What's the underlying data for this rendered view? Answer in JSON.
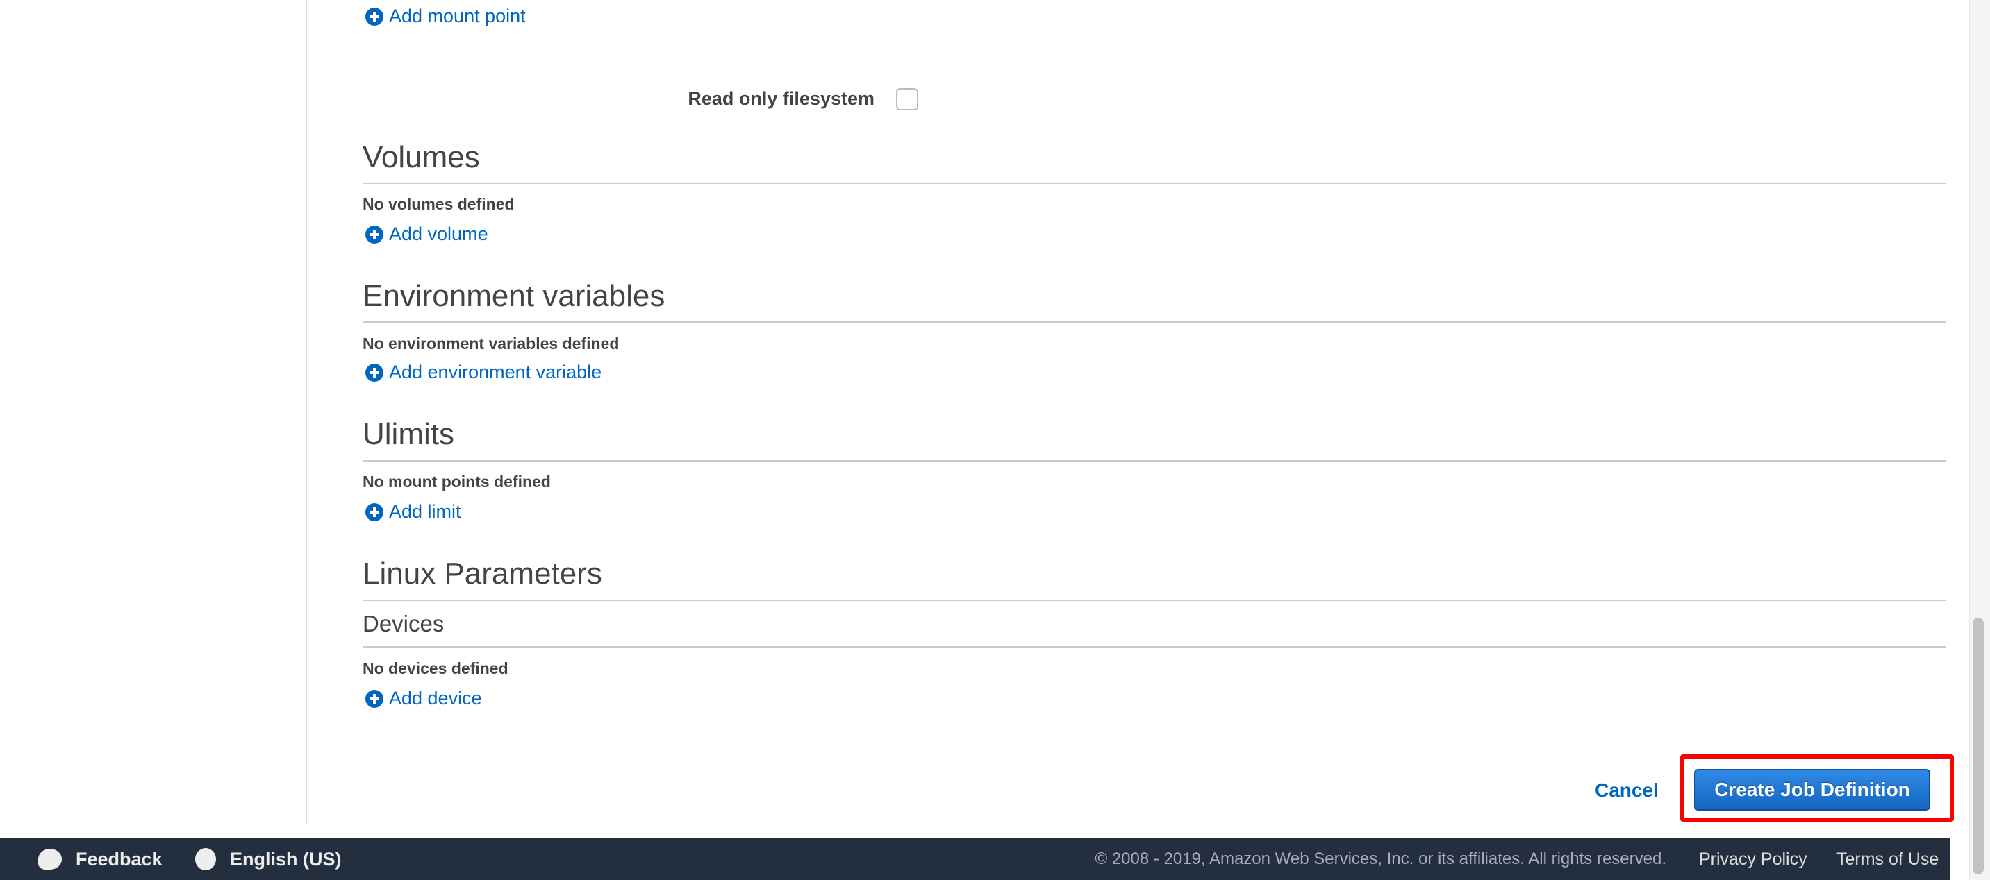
{
  "form": {
    "add_mount_point": "Add mount point",
    "read_only_label": "Read only filesystem",
    "read_only_checked": false,
    "sections": {
      "volumes": {
        "title": "Volumes",
        "empty": "No volumes defined",
        "add": "Add volume"
      },
      "env": {
        "title": "Environment variables",
        "empty": "No environment variables defined",
        "add": "Add environment variable"
      },
      "ulimits": {
        "title": "Ulimits",
        "empty": "No mount points defined",
        "add": "Add limit"
      },
      "linux": {
        "title": "Linux Parameters",
        "devices_title": "Devices",
        "empty": "No devices defined",
        "add": "Add device"
      }
    },
    "cancel": "Cancel",
    "submit": "Create Job Definition"
  },
  "footer": {
    "feedback": "Feedback",
    "language": "English (US)",
    "copyright": "© 2008 - 2019, Amazon Web Services, Inc. or its affiliates. All rights reserved.",
    "privacy": "Privacy Policy",
    "terms": "Terms of Use"
  },
  "colors": {
    "link": "#0066c0",
    "button": "#1a73d0",
    "highlight": "#ff0000",
    "footer_bg": "#232f3e"
  },
  "icons": {
    "add": "plus-circle-icon",
    "feedback": "speech-bubble-icon",
    "language": "globe-icon"
  }
}
